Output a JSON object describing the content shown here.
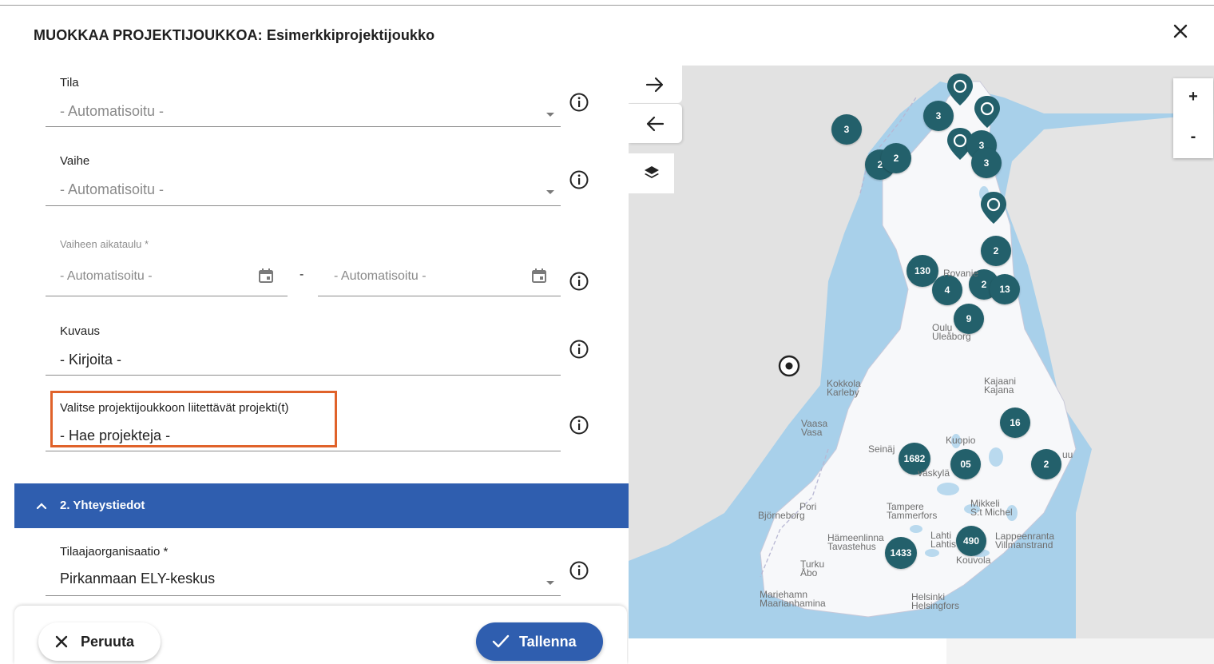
{
  "dialog": {
    "title": "MUOKKAA PROJEKTIJOUKKOA: Esimerkkiprojektijoukko",
    "close_icon": "close-icon"
  },
  "form": {
    "tila": {
      "label": "Tila",
      "value": "- Automatisoitu -"
    },
    "vaihe": {
      "label": "Vaihe",
      "value": "- Automatisoitu -"
    },
    "vaiheen_aikataulu": {
      "label": "Vaiheen aikataulu *",
      "start": "- Automatisoitu -",
      "separator": "-",
      "end": "- Automatisoitu -"
    },
    "kuvaus": {
      "label": "Kuvaus",
      "value": "- Kirjoita -"
    },
    "projektit": {
      "label": "Valitse projektijoukkoon liitettävät projekti(t)",
      "value": "- Hae projekteja -"
    },
    "section2": {
      "title": "2. Yhteystiedot"
    },
    "tilaaja": {
      "label": "Tilaajaorganisaatio *",
      "value": "Pirkanmaan ELY-keskus"
    }
  },
  "footer": {
    "cancel_label": "Peruuta",
    "save_label": "Tallenna"
  },
  "map": {
    "zoom_in": "+",
    "zoom_out": "-",
    "clusters": [
      "3",
      "3",
      "2",
      "2",
      "3",
      "3",
      "2",
      "130",
      "2",
      "4",
      "13",
      "9",
      "16",
      "1682",
      "05",
      "2",
      "490",
      "1433"
    ],
    "cities": [
      {
        "name": "Rovanie"
      },
      {
        "name": "Oulu",
        "alt": "Uleåborg"
      },
      {
        "name": "Kokkola",
        "alt": "Karleby"
      },
      {
        "name": "Kajaani",
        "alt": "Kajana"
      },
      {
        "name": "Vaasa",
        "alt": "Vasa"
      },
      {
        "name": "Seinäj"
      },
      {
        "name": "Kuopio"
      },
      {
        "name": "uu"
      },
      {
        "name": "väskylä"
      },
      {
        "name": "Pori",
        "alt": "Björneborg"
      },
      {
        "name": "Tampere",
        "alt": "Tammerfors"
      },
      {
        "name": "Mikkeli",
        "alt": "S:t Michel"
      },
      {
        "name": "Hämeenlinna",
        "alt": "Tavastehus"
      },
      {
        "name": "Lahti",
        "alt": "Lahtis"
      },
      {
        "name": "Lappeenranta",
        "alt": "Villmanstrand"
      },
      {
        "name": "Kouvola"
      },
      {
        "name": "Turku",
        "alt": "Åbo"
      },
      {
        "name": "Mariehamn",
        "alt": "Maarianhamina"
      },
      {
        "name": "Helsinki",
        "alt": "Helsingfors"
      }
    ],
    "colors": {
      "cluster": "#23606b",
      "water": "#a8d0ea",
      "land": "#e2e2e2",
      "finland": "#f7f8fa"
    }
  }
}
